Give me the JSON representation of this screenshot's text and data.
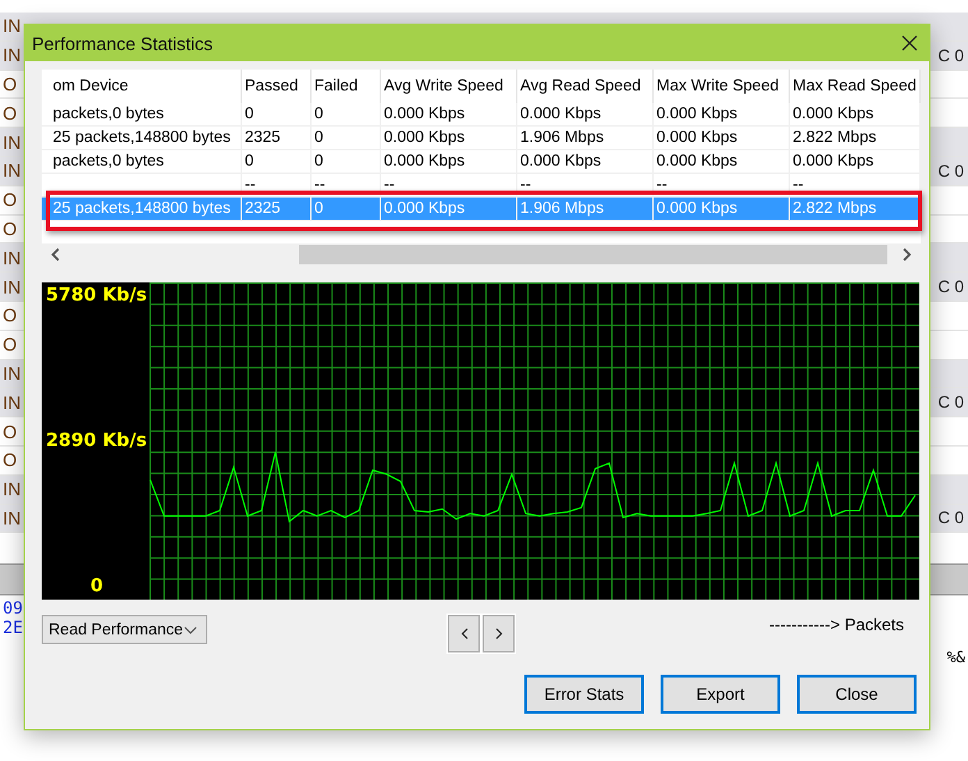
{
  "background": {
    "rows": [
      {
        "label": "IN",
        "note": "",
        "shaded": true
      },
      {
        "label": "IN",
        "note": "C 0",
        "shaded": true
      },
      {
        "label": "O",
        "note": "",
        "shaded": false
      },
      {
        "label": "O",
        "note": "",
        "shaded": false
      },
      {
        "label": "IN",
        "note": "",
        "shaded": true
      },
      {
        "label": "IN",
        "note": "C 0",
        "shaded": true
      },
      {
        "label": "O",
        "note": "",
        "shaded": false
      },
      {
        "label": "O",
        "note": "",
        "shaded": false
      },
      {
        "label": "IN",
        "note": "",
        "shaded": true
      },
      {
        "label": "IN",
        "note": "C 0",
        "shaded": true
      },
      {
        "label": "O",
        "note": "",
        "shaded": false
      },
      {
        "label": "O",
        "note": "",
        "shaded": false
      },
      {
        "label": "IN",
        "note": "",
        "shaded": true
      },
      {
        "label": "IN",
        "note": "C 0",
        "shaded": true
      },
      {
        "label": "O",
        "note": "",
        "shaded": false
      },
      {
        "label": "O",
        "note": "",
        "shaded": false
      },
      {
        "label": "IN",
        "note": "",
        "shaded": true
      },
      {
        "label": "IN",
        "note": "C 0",
        "shaded": true
      }
    ],
    "hex_lines": [
      "09",
      "2E"
    ],
    "side_text": "%&"
  },
  "dialog": {
    "title": "Performance Statistics",
    "table": {
      "columns": [
        "om Device",
        "Passed",
        "Failed",
        "Avg Write Speed",
        "Avg Read Speed",
        "Max Write Speed",
        "Max Read Speed"
      ],
      "rows": [
        {
          "cells": [
            "packets,0 bytes",
            "0",
            "0",
            "0.000 Kbps",
            "0.000 Kbps",
            "0.000 Kbps",
            "0.000 Kbps"
          ],
          "selected": false,
          "outlined": false
        },
        {
          "cells": [
            "25 packets,148800 bytes",
            "2325",
            "0",
            "0.000 Kbps",
            "1.906 Mbps",
            "0.000 Kbps",
            "2.822 Mbps"
          ],
          "selected": false,
          "outlined": false
        },
        {
          "cells": [
            "packets,0 bytes",
            "0",
            "0",
            "0.000 Kbps",
            "0.000 Kbps",
            "0.000 Kbps",
            "0.000 Kbps"
          ],
          "selected": false,
          "outlined": false
        },
        {
          "cells": [
            "",
            "--",
            "--",
            "--",
            "--",
            "--",
            "--"
          ],
          "selected": false,
          "outlined": false
        },
        {
          "cells": [
            "25 packets,148800 bytes",
            "2325",
            "0",
            "0.000 Kbps",
            "1.906 Mbps",
            "0.000 Kbps",
            "2.822 Mbps"
          ],
          "selected": true,
          "outlined": true
        }
      ]
    },
    "chart_data": {
      "type": "line",
      "grid": true,
      "xlabel": "-----------> Packets",
      "ylim": [
        -70,
        6231
      ],
      "yticks": [
        0,
        {
          "value": 2890,
          "label": "2890 Kb/s"
        },
        {
          "value": 5780,
          "label": "5780 Kb/s"
        }
      ],
      "series": [
        {
          "color": "#00ff00",
          "values": [
            2310,
            1590,
            1590,
            1590,
            1590,
            1700,
            2560,
            1590,
            1700,
            2860,
            1480,
            1700,
            1590,
            1700,
            1560,
            1700,
            2500,
            2420,
            2280,
            1700,
            1670,
            1730,
            1530,
            1640,
            1590,
            1700,
            2420,
            1640,
            1590,
            1640,
            1670,
            1760,
            2530,
            2640,
            1560,
            1640,
            1590,
            1590,
            1590,
            1590,
            1640,
            1700,
            2640,
            1590,
            1700,
            2640,
            1590,
            1700,
            2640,
            1590,
            1700,
            1700,
            2500,
            1590,
            1590,
            2000
          ]
        }
      ]
    },
    "dropdown": {
      "value": "Read Performance"
    },
    "buttons": [
      "Error Stats",
      "Export",
      "Close"
    ]
  }
}
